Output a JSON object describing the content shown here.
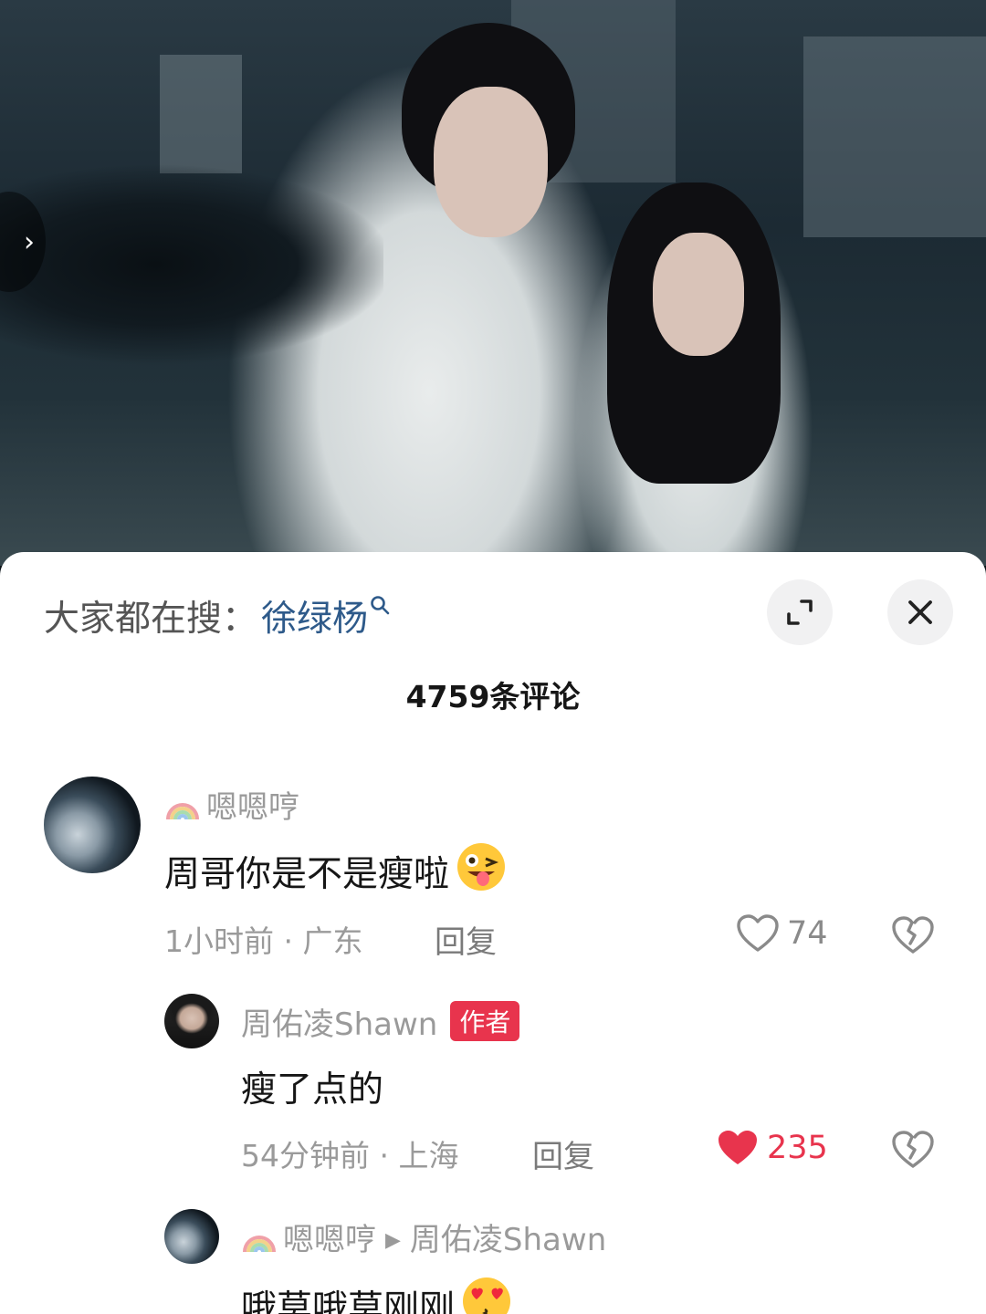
{
  "video": {
    "side_arrow_icon": "chevron-right-icon"
  },
  "sheet": {
    "search_prefix": "大家都在搜：",
    "search_keyword": "徐绿杨",
    "expand_icon": "expand-icon",
    "close_icon": "close-icon",
    "comment_count_title": "4759条评论"
  },
  "comments": [
    {
      "username": "嗯嗯哼",
      "username_prefix_icon": "rainbow-icon",
      "text": "周哥你是不是瘦啦",
      "emoji": "winking-tongue-emoji",
      "time_location": "1小时前 · 广东",
      "reply_label": "回复",
      "likes": "74",
      "liked": false
    },
    {
      "username": "周佑凌Shawn",
      "badge": "作者",
      "text": "瘦了点的",
      "time_location": "54分钟前 · 上海",
      "reply_label": "回复",
      "likes": "235",
      "liked": true
    },
    {
      "username": "嗯嗯哼",
      "username_prefix_icon": "rainbow-icon",
      "reply_to": "周佑凌Shawn",
      "text": "哦莫哦莫刚刚",
      "emoji": "heart-eyes-kiss-emoji"
    }
  ],
  "colors": {
    "accent_red": "#e8344d",
    "keyword_blue": "#2e5a8a",
    "muted_gray": "#9a9a9a"
  }
}
